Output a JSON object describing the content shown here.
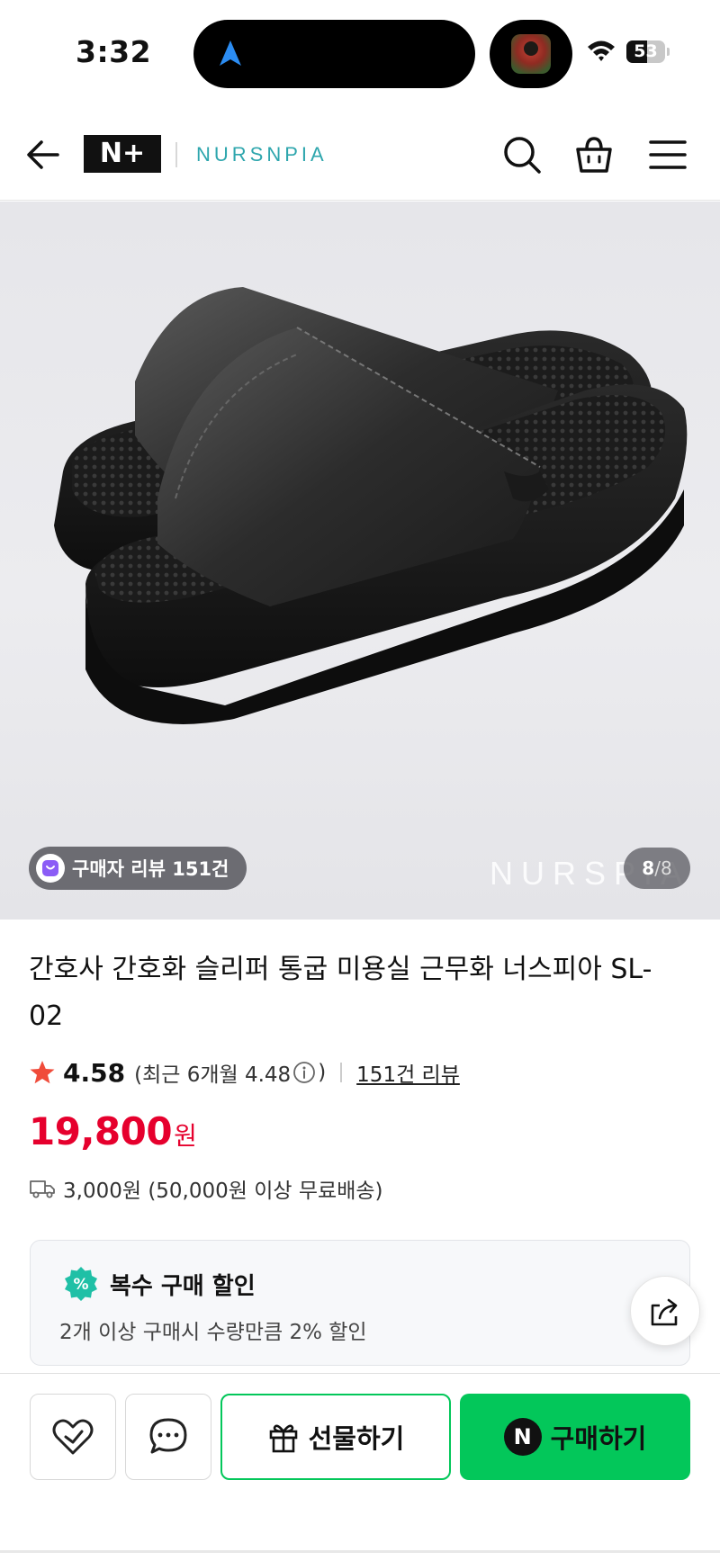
{
  "status_bar": {
    "time": "3:32",
    "battery": "53",
    "battery_level": 0.53
  },
  "header": {
    "brand_logo": "N+",
    "brand_name": "NURSNPIA",
    "icons": [
      "back-icon",
      "search-icon",
      "shopping-bag-icon",
      "menu-icon"
    ]
  },
  "gallery": {
    "review_chip": "구매자 리뷰 151건",
    "watermark": "NURSPIA",
    "current_page": "8",
    "separator": "/",
    "total_pages": "8"
  },
  "product": {
    "title": "간호사 간호화 슬리퍼 통굽 미용실 근무화 너스피아 SL-02",
    "rating": "4.58",
    "recent_rating_prefix": "(최근 6개월 4.48",
    "recent_rating_suffix": ")",
    "review_link": "151건 리뷰",
    "price": "19,800",
    "price_unit": "원",
    "delivery": "3,000원 (50,000원 이상 무료배송)"
  },
  "discount": {
    "badge": "%",
    "title": "복수 구매 할인",
    "description": "2개 이상 구매시 수량만큼 2% 할인"
  },
  "bottom_bar": {
    "gift_label": "선물하기",
    "npay_badge": "N",
    "buy_label": "구매하기"
  },
  "colors": {
    "price": "#e6002d",
    "accent_green": "#03c75a",
    "brand_teal": "#2ea6ad",
    "star": "#f04b3a",
    "discount_badge": "#1fc0a6"
  }
}
